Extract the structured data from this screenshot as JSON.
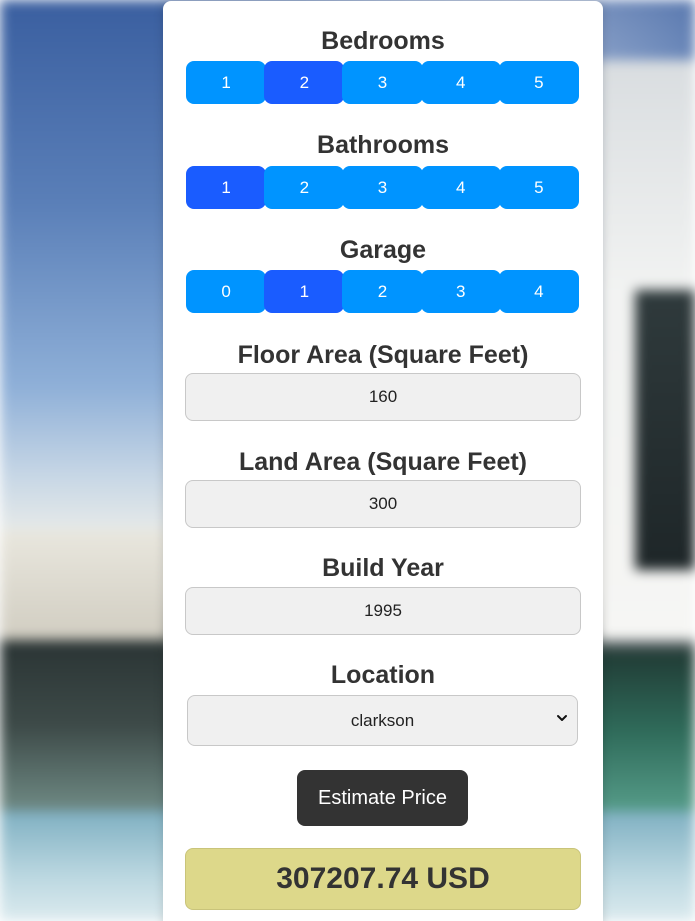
{
  "bedrooms": {
    "label": "Bedrooms",
    "options": [
      "1",
      "2",
      "3",
      "4",
      "5"
    ],
    "selected": "2"
  },
  "bathrooms": {
    "label": "Bathrooms",
    "options": [
      "1",
      "2",
      "3",
      "4",
      "5"
    ],
    "selected": "1"
  },
  "garage": {
    "label": "Garage",
    "options": [
      "0",
      "1",
      "2",
      "3",
      "4"
    ],
    "selected": "1"
  },
  "floor_area": {
    "label": "Floor Area (Square Feet)",
    "value": "160"
  },
  "land_area": {
    "label": "Land Area (Square Feet)",
    "value": "300"
  },
  "build_year": {
    "label": "Build Year",
    "value": "1995"
  },
  "location": {
    "label": "Location",
    "selected": "clarkson"
  },
  "estimate_button": {
    "label": "Estimate Price"
  },
  "result": {
    "text": "307207.74 USD"
  },
  "colors": {
    "segment": "#0094ff",
    "segment_active": "#1a5cff",
    "button_dark": "#333333",
    "result_bg": "#ddd88a"
  },
  "icons": {
    "select_chevron": "chevron-down-icon"
  }
}
